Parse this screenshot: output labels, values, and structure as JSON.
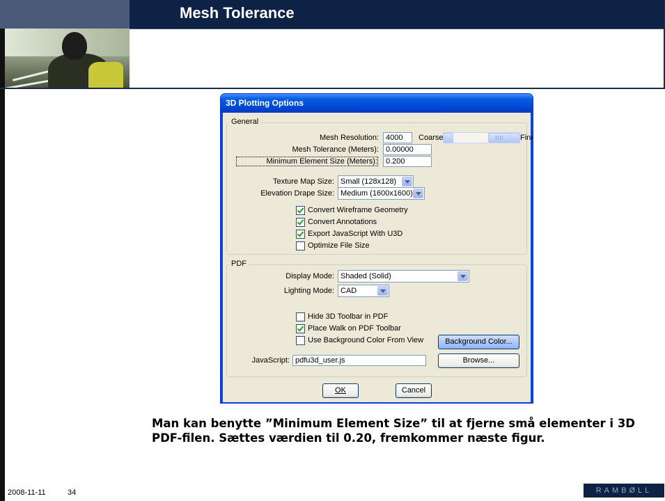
{
  "slide": {
    "title": "Mesh Tolerance",
    "body_text": "Man kan benytte ”Minimum Element Size” til at fjerne små elementer i 3D PDF-filen. Sættes værdien til 0.20, fremkommer næste figur.",
    "footer_date": "2008-11-11",
    "footer_page": "34",
    "logo_text": "RAMBØLL"
  },
  "dialog": {
    "title": "3D Plotting Options",
    "general": {
      "legend": "General",
      "mesh_resolution_label": "Mesh Resolution:",
      "mesh_resolution_value": "4000",
      "coarse_label": "Coarse",
      "fine_label": "Fine",
      "slider_level": 0.8,
      "mesh_tolerance_label": "Mesh Tolerance (Meters):",
      "mesh_tolerance_value": "0.00000",
      "min_element_label": "Minimum Element Size (Meters):",
      "min_element_value": "0.200",
      "texture_map_label": "Texture Map Size:",
      "texture_map_value": "Small (128x128)",
      "elevation_drape_label": "Elevation Drape Size:",
      "elevation_drape_value": "Medium (1600x1600)",
      "checkboxes": [
        {
          "label": "Convert Wireframe Geometry",
          "checked": true
        },
        {
          "label": "Convert Annotations",
          "checked": true
        },
        {
          "label": "Export JavaScript With U3D",
          "checked": true
        },
        {
          "label": "Optimize File Size",
          "checked": false
        }
      ]
    },
    "pdf": {
      "legend": "PDF",
      "display_mode_label": "Display Mode:",
      "display_mode_value": "Shaded (Solid)",
      "lighting_mode_label": "Lighting Mode:",
      "lighting_mode_value": "CAD",
      "checkboxes": [
        {
          "label": "Hide 3D Toolbar in PDF",
          "checked": false
        },
        {
          "label": "Place Walk on PDF Toolbar",
          "checked": true
        },
        {
          "label": "Use Background Color From View",
          "checked": false
        }
      ],
      "background_color_button": "Background Color...",
      "javascript_label": "JavaScript:",
      "javascript_value": "pdfu3d_user.js",
      "browse_button": "Browse..."
    },
    "ok_button": "OK",
    "cancel_button": "Cancel"
  }
}
